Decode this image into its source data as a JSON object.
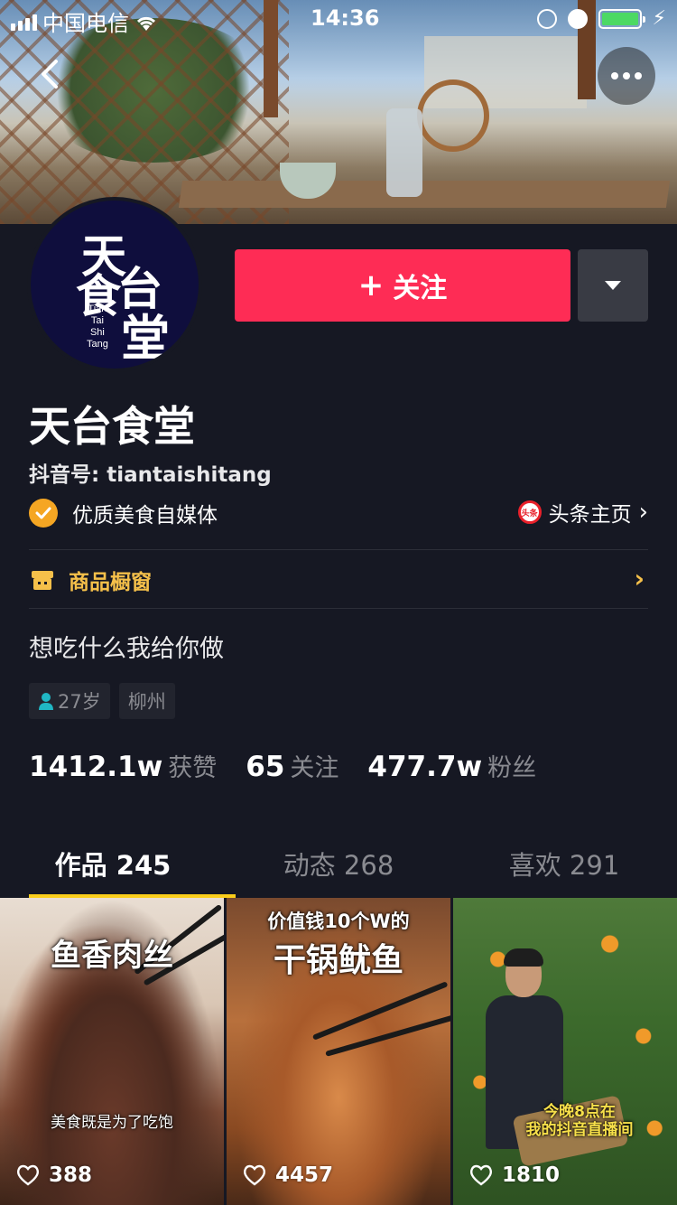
{
  "status_bar": {
    "carrier": "中国电信",
    "time": "14:36"
  },
  "profile": {
    "avatar": {
      "chars": [
        "天",
        "食",
        "台",
        "堂"
      ],
      "small_lines": [
        "Tian",
        "Tai",
        "Shi",
        "Tang"
      ]
    },
    "follow_label": "关注",
    "name": "天台食堂",
    "douyin_id": "抖音号: tiantaishitang",
    "verified_text": "优质美食自媒体",
    "toutiao_icon_text": "头条",
    "toutiao_link": "头条主页",
    "shop_label": "商品橱窗",
    "bio": "想吃什么我给你做",
    "tags": {
      "age": "27岁",
      "city": "柳州"
    },
    "stats": [
      {
        "value": "1412.1w",
        "label": "获赞"
      },
      {
        "value": "65",
        "label": "关注"
      },
      {
        "value": "477.7w",
        "label": "粉丝"
      }
    ]
  },
  "tabs": [
    {
      "label": "作品 245",
      "active": true
    },
    {
      "label": "动态 268",
      "active": false
    },
    {
      "label": "喜欢 291",
      "active": false
    }
  ],
  "videos": [
    {
      "title": "鱼香肉丝",
      "caption": "美食既是为了吃饱",
      "likes": "388"
    },
    {
      "title_top": "价值钱10个W的",
      "title": "干锅鱿鱼",
      "likes": "4457"
    },
    {
      "caption_line1": "今晚8点在",
      "caption_line2": "我的抖音直播间",
      "likes": "1810"
    }
  ],
  "colors": {
    "background": "#161823",
    "follow_button": "#fe2c55",
    "tab_indicator": "#facd1a",
    "shop_accent": "#f5c04a",
    "verified_badge": "#f5a623"
  },
  "icons": [
    "back-arrow-icon",
    "more-icon",
    "plus-icon",
    "dropdown-arrow-icon",
    "verified-check-icon",
    "toutiao-icon",
    "chevron-right-icon",
    "shop-icon",
    "person-icon",
    "heart-icon",
    "signal-icon",
    "wifi-icon",
    "battery-icon"
  ]
}
